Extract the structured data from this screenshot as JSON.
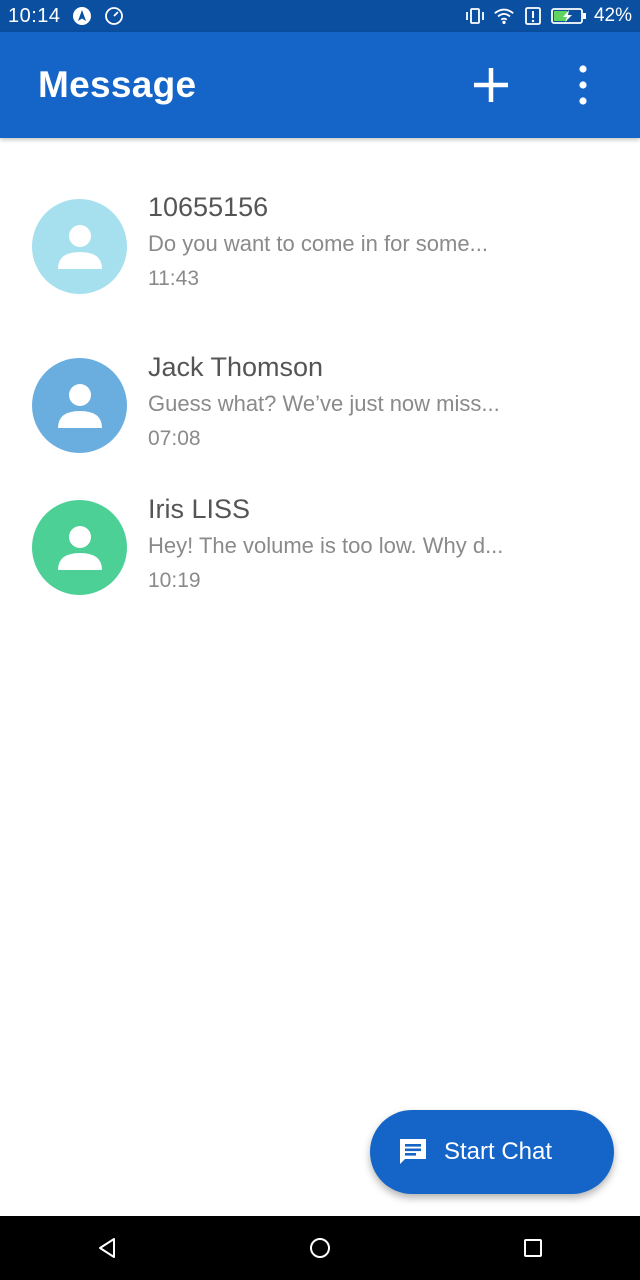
{
  "status_bar": {
    "time": "10:14",
    "battery_percent": "42%",
    "icons": [
      "navigation-icon",
      "data-saver-icon",
      "vibrate-icon",
      "wifi-icon",
      "alert-icon",
      "battery-charging-icon"
    ]
  },
  "app_bar": {
    "title": "Message",
    "actions": [
      "add-icon",
      "more-vert-icon"
    ]
  },
  "conversations": [
    {
      "name": "10655156",
      "preview": "Do you want to come in for some...",
      "time": "11:43",
      "avatar_color": "#a6e0ee"
    },
    {
      "name": "Jack Thomson",
      "preview": "Guess what? We’ve just now miss...",
      "time": "07:08",
      "avatar_color": "#6aaee0"
    },
    {
      "name": "Iris LISS",
      "preview": "Hey! The volume is too low. Why d...",
      "time": "10:19",
      "avatar_color": "#4cd095"
    }
  ],
  "fab": {
    "label": "Start Chat",
    "icon": "chat-icon"
  },
  "nav_bar": {
    "buttons": [
      "back-icon",
      "home-icon",
      "recents-icon"
    ]
  },
  "colors": {
    "status_bar": "#0a4fa0",
    "primary": "#1565c8",
    "name_text": "#555555",
    "secondary_text": "#8a8a8a"
  }
}
